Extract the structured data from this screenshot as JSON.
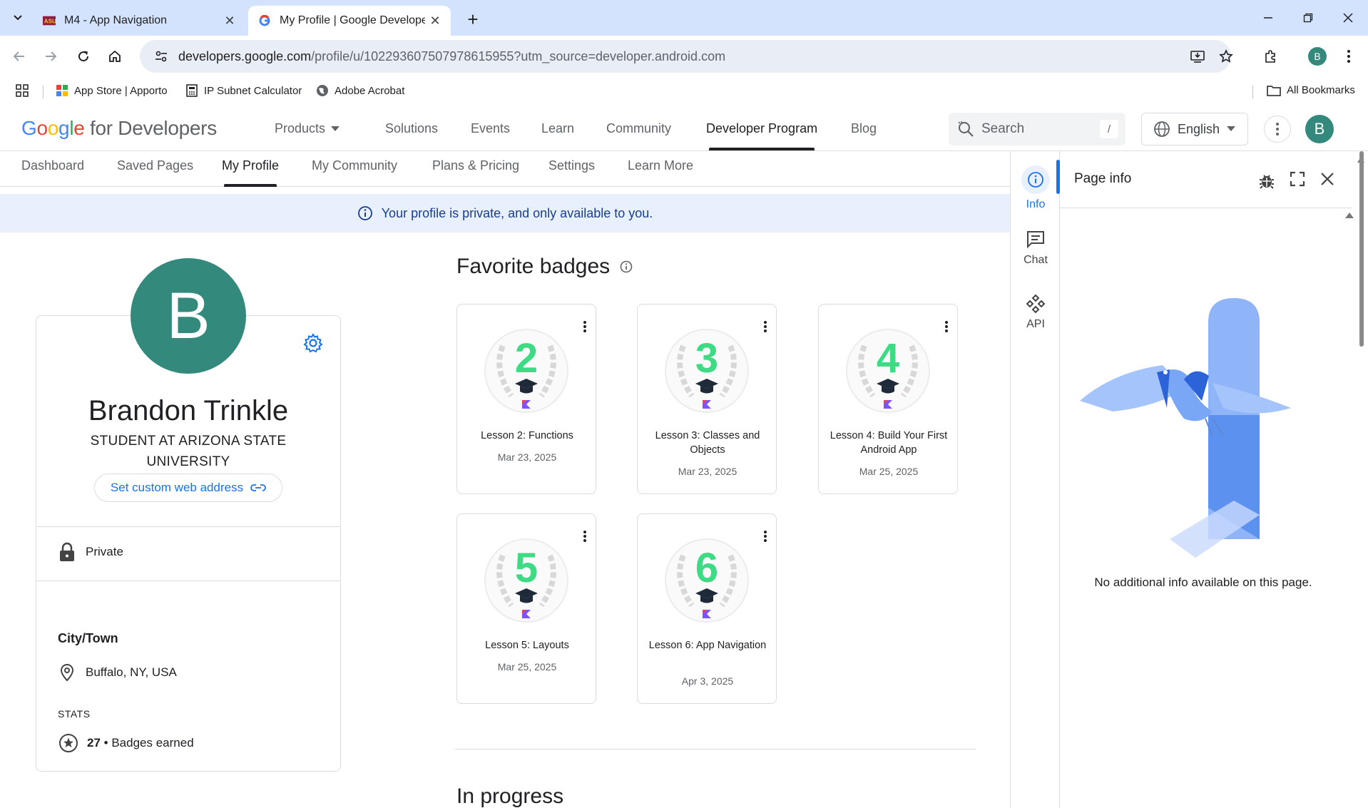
{
  "browser": {
    "tabs": [
      {
        "title": "M4 - App Navigation",
        "favicon": "asu-logo-icon"
      },
      {
        "title": "My Profile | Google Developer Pro",
        "favicon": "google-g-icon"
      }
    ],
    "url_host": "developers.google.com",
    "url_path": "/profile/u/102293607507978615955?utm_source=developer.android.com",
    "profile_initial": "B",
    "bookmarks": [
      "App Store | Apporto",
      "IP Subnet Calculator",
      "Adobe Acrobat"
    ],
    "all_bookmarks": "All Bookmarks"
  },
  "site": {
    "logo_google": "Google",
    "logo_suffix": "for Developers",
    "nav": [
      "Products",
      "Solutions",
      "Events",
      "Learn",
      "Community",
      "Developer Program",
      "Blog"
    ],
    "active_nav": "Developer Program",
    "search_placeholder": "Search",
    "search_shortcut": "/",
    "language": "English",
    "avatar_initial": "B"
  },
  "subnav": {
    "items": [
      "Dashboard",
      "Saved Pages",
      "My Profile",
      "My Community",
      "Plans & Pricing",
      "Settings",
      "Learn More"
    ],
    "active": "My Profile"
  },
  "banner": {
    "text": "Your profile is private, and only available to you."
  },
  "profile": {
    "initial": "B",
    "name": "Brandon Trinkle",
    "title": "STUDENT AT ARIZONA STATE UNIVERSITY",
    "custom_url_label": "Set custom web address",
    "visibility": "Private",
    "city_heading": "City/Town",
    "location": "Buffalo, NY, USA",
    "stats_label": "STATS",
    "badges_count": "27",
    "badges_label": "Badges earned"
  },
  "favorites": {
    "title": "Favorite badges",
    "badges": [
      {
        "number": "2",
        "name": "Lesson 2: Functions",
        "date": "Mar 23, 2025"
      },
      {
        "number": "3",
        "name": "Lesson 3: Classes and Objects",
        "date": "Mar 23, 2025"
      },
      {
        "number": "4",
        "name": "Lesson 4: Build Your First Android App",
        "date": "Mar 25, 2025"
      },
      {
        "number": "5",
        "name": "Lesson 5: Layouts",
        "date": "Mar 25, 2025"
      },
      {
        "number": "6",
        "name": "Lesson 6: App Navigation",
        "date": "Apr 3, 2025"
      }
    ]
  },
  "in_progress_title": "In progress",
  "side_panel": {
    "rail": [
      {
        "label": "Info",
        "icon": "info-icon"
      },
      {
        "label": "Chat",
        "icon": "chat-icon"
      },
      {
        "label": "API",
        "icon": "api-icon"
      }
    ],
    "title": "Page info",
    "empty_message": "No additional info available on this page."
  },
  "colors": {
    "accent": "#1a73e8",
    "avatar": "#338a7c",
    "badge_number": "#3ddc84",
    "banner_bg": "#e8f0fe",
    "tabstrip_bg": "#d3e3fd"
  }
}
